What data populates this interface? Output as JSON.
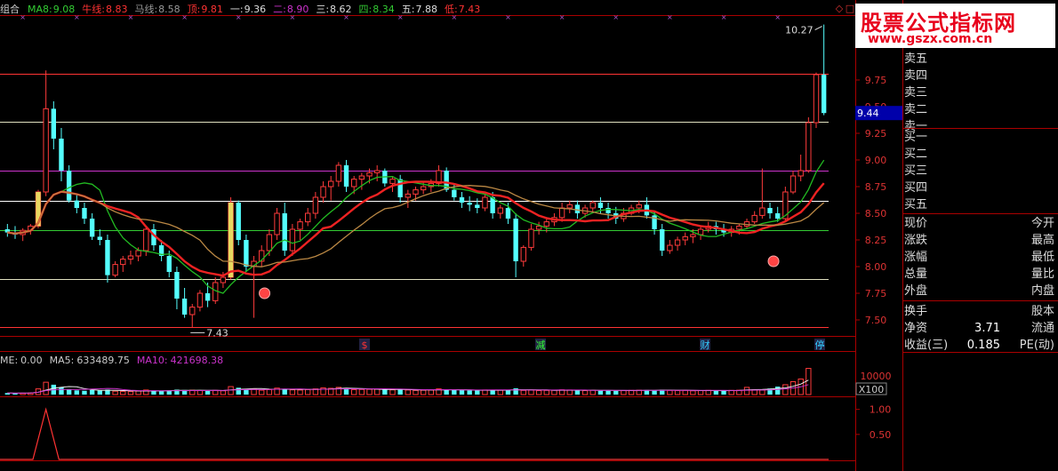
{
  "indicator_bar": [
    {
      "label": "组合",
      "value": "",
      "color": "#cccccc"
    },
    {
      "label": "MA8:",
      "value": "9.08",
      "color": "#33cc33"
    },
    {
      "label": "牛线:",
      "value": "8.83",
      "color": "#ff3333"
    },
    {
      "label": "马线:",
      "value": "8.58",
      "color": "#999999"
    },
    {
      "label": "顶:",
      "value": "9.81",
      "color": "#ff3333"
    },
    {
      "label": "一:",
      "value": "9.36",
      "color": "#dddddd"
    },
    {
      "label": "二:",
      "value": "8.90",
      "color": "#cc33cc"
    },
    {
      "label": "三:",
      "value": "8.62",
      "color": "#dddddd"
    },
    {
      "label": "四:",
      "value": "8.34",
      "color": "#33cc33"
    },
    {
      "label": "五:",
      "value": "7.88",
      "color": "#dddddd"
    },
    {
      "label": "低:",
      "value": "7.43",
      "color": "#ff3333"
    }
  ],
  "volume_bar": [
    {
      "label": "ME:",
      "value": "0.00",
      "color": "#cccccc"
    },
    {
      "label": "MA5:",
      "value": "633489.75",
      "color": "#cccccc"
    },
    {
      "label": "MA10:",
      "value": "421698.38",
      "color": "#cc33cc"
    }
  ],
  "watermark": {
    "title": "股票公式指标网",
    "url": "www.gszx.com.cn"
  },
  "annotations": {
    "high": "10.27",
    "low": "7.43",
    "current_price": "9.44",
    "vol_unit": "X100"
  },
  "event_markers": [
    {
      "label": "$",
      "color": "#ff3333"
    },
    {
      "label": "减",
      "color": "#33ff33"
    },
    {
      "label": "财",
      "color": "#33ccff"
    },
    {
      "label": "停",
      "color": "#33ccff"
    }
  ],
  "price_axis": [
    "9.75",
    "9.50",
    "9.25",
    "9.00",
    "8.75",
    "8.50",
    "8.25",
    "8.00",
    "7.75",
    "7.50"
  ],
  "volume_axis": [
    "10000"
  ],
  "sub_axis": [
    "1.00",
    "0.50"
  ],
  "panel": {
    "sell": [
      "卖五",
      "卖四",
      "卖三",
      "卖二",
      "卖一"
    ],
    "buy": [
      "买一",
      "买二",
      "买三",
      "买四",
      "买五"
    ],
    "stats": [
      {
        "l": "现价",
        "v": "",
        "r": "今开"
      },
      {
        "l": "涨跌",
        "v": "",
        "r": "最高"
      },
      {
        "l": "涨幅",
        "v": "",
        "r": "最低"
      },
      {
        "l": "总量",
        "v": "",
        "r": "量比"
      },
      {
        "l": "外盘",
        "v": "",
        "r": "内盘"
      },
      {
        "l": "换手",
        "v": "",
        "r": "股本"
      },
      {
        "l": "净资",
        "v": "3.71",
        "r": "流通"
      },
      {
        "l": "收益(三)",
        "v": "0.185",
        "r": "PE(动)"
      }
    ]
  },
  "chart_data": {
    "type": "candlestick",
    "ylim": [
      7.35,
      10.35
    ],
    "levels": [
      {
        "name": "顶",
        "value": 9.81,
        "color": "#ff3333"
      },
      {
        "name": "一",
        "value": 9.36,
        "color": "#e0e0c0"
      },
      {
        "name": "二",
        "value": 8.9,
        "color": "#cc33cc"
      },
      {
        "name": "三",
        "value": 8.62,
        "color": "#ffffff"
      },
      {
        "name": "四",
        "value": 8.34,
        "color": "#33cc33"
      },
      {
        "name": "五",
        "value": 7.88,
        "color": "#e0e0c0"
      },
      {
        "name": "低",
        "value": 7.43,
        "color": "#ff3333"
      }
    ],
    "candles": [
      [
        8.35,
        8.4,
        8.28,
        8.32
      ],
      [
        8.32,
        8.38,
        8.26,
        8.3
      ],
      [
        8.3,
        8.36,
        8.24,
        8.34
      ],
      [
        8.34,
        8.4,
        8.3,
        8.38
      ],
      [
        8.38,
        8.72,
        8.36,
        8.7
      ],
      [
        8.7,
        9.84,
        8.66,
        9.48
      ],
      [
        9.48,
        9.55,
        9.1,
        9.2
      ],
      [
        9.2,
        9.3,
        8.8,
        8.9
      ],
      [
        8.9,
        8.95,
        8.6,
        8.62
      ],
      [
        8.62,
        8.68,
        8.5,
        8.55
      ],
      [
        8.55,
        8.6,
        8.4,
        8.45
      ],
      [
        8.45,
        8.5,
        8.25,
        8.28
      ],
      [
        8.28,
        8.35,
        8.2,
        8.25
      ],
      [
        8.25,
        8.3,
        7.85,
        7.92
      ],
      [
        7.92,
        8.05,
        7.9,
        8.02
      ],
      [
        8.02,
        8.1,
        7.95,
        8.07
      ],
      [
        8.07,
        8.15,
        8.02,
        8.1
      ],
      [
        8.1,
        8.18,
        8.05,
        8.15
      ],
      [
        8.15,
        8.38,
        8.1,
        8.35
      ],
      [
        8.35,
        8.4,
        8.15,
        8.2
      ],
      [
        8.2,
        8.25,
        8.05,
        8.1
      ],
      [
        8.1,
        8.15,
        7.9,
        7.95
      ],
      [
        7.95,
        8.0,
        7.6,
        7.7
      ],
      [
        7.7,
        7.8,
        7.52,
        7.55
      ],
      [
        7.55,
        7.65,
        7.43,
        7.62
      ],
      [
        7.62,
        7.78,
        7.58,
        7.75
      ],
      [
        7.75,
        7.85,
        7.62,
        7.68
      ],
      [
        7.68,
        7.9,
        7.65,
        7.85
      ],
      [
        7.85,
        7.95,
        7.8,
        7.9
      ],
      [
        7.9,
        8.65,
        7.88,
        8.6
      ],
      [
        8.6,
        8.62,
        8.2,
        8.25
      ],
      [
        8.25,
        8.3,
        7.95,
        8.0
      ],
      [
        8.0,
        8.1,
        7.52,
        8.05
      ],
      [
        8.05,
        8.2,
        8.0,
        8.15
      ],
      [
        8.15,
        8.35,
        8.1,
        8.3
      ],
      [
        8.3,
        8.55,
        8.25,
        8.5
      ],
      [
        8.5,
        8.6,
        8.1,
        8.15
      ],
      [
        8.15,
        8.4,
        8.1,
        8.35
      ],
      [
        8.35,
        8.45,
        8.25,
        8.42
      ],
      [
        8.42,
        8.55,
        8.38,
        8.5
      ],
      [
        8.5,
        8.7,
        8.45,
        8.65
      ],
      [
        8.65,
        8.8,
        8.6,
        8.75
      ],
      [
        8.75,
        8.85,
        8.62,
        8.8
      ],
      [
        8.8,
        8.98,
        8.75,
        8.95
      ],
      [
        8.95,
        9.0,
        8.7,
        8.75
      ],
      [
        8.75,
        8.85,
        8.68,
        8.82
      ],
      [
        8.82,
        8.88,
        8.72,
        8.85
      ],
      [
        8.85,
        8.92,
        8.78,
        8.88
      ],
      [
        8.88,
        8.95,
        8.8,
        8.9
      ],
      [
        8.9,
        8.92,
        8.75,
        8.78
      ],
      [
        8.78,
        8.85,
        8.7,
        8.82
      ],
      [
        8.82,
        8.86,
        8.6,
        8.65
      ],
      [
        8.65,
        8.72,
        8.55,
        8.68
      ],
      [
        8.68,
        8.75,
        8.62,
        8.72
      ],
      [
        8.72,
        8.8,
        8.68,
        8.75
      ],
      [
        8.75,
        8.82,
        8.7,
        8.78
      ],
      [
        8.78,
        8.95,
        8.75,
        8.9
      ],
      [
        8.9,
        8.93,
        8.7,
        8.72
      ],
      [
        8.72,
        8.78,
        8.62,
        8.65
      ],
      [
        8.65,
        8.7,
        8.55,
        8.6
      ],
      [
        8.6,
        8.66,
        8.52,
        8.58
      ],
      [
        8.58,
        8.64,
        8.5,
        8.55
      ],
      [
        8.55,
        8.68,
        8.52,
        8.65
      ],
      [
        8.65,
        8.7,
        8.45,
        8.5
      ],
      [
        8.5,
        8.58,
        8.45,
        8.55
      ],
      [
        8.55,
        8.6,
        8.4,
        8.45
      ],
      [
        8.45,
        8.5,
        7.9,
        8.05
      ],
      [
        8.05,
        8.2,
        8.0,
        8.18
      ],
      [
        8.18,
        8.4,
        8.15,
        8.35
      ],
      [
        8.35,
        8.42,
        8.3,
        8.38
      ],
      [
        8.38,
        8.45,
        8.32,
        8.42
      ],
      [
        8.42,
        8.5,
        8.38,
        8.46
      ],
      [
        8.46,
        8.6,
        8.42,
        8.55
      ],
      [
        8.55,
        8.62,
        8.5,
        8.58
      ],
      [
        8.58,
        8.62,
        8.45,
        8.5
      ],
      [
        8.5,
        8.58,
        8.46,
        8.55
      ],
      [
        8.55,
        8.62,
        8.5,
        8.6
      ],
      [
        8.6,
        8.65,
        8.5,
        8.55
      ],
      [
        8.55,
        8.6,
        8.45,
        8.5
      ],
      [
        8.5,
        8.56,
        8.4,
        8.45
      ],
      [
        8.45,
        8.55,
        8.42,
        8.5
      ],
      [
        8.5,
        8.58,
        8.48,
        8.55
      ],
      [
        8.55,
        8.62,
        8.5,
        8.58
      ],
      [
        8.58,
        8.65,
        8.45,
        8.48
      ],
      [
        8.48,
        8.52,
        8.3,
        8.35
      ],
      [
        8.35,
        8.4,
        8.1,
        8.15
      ],
      [
        8.15,
        8.25,
        8.12,
        8.2
      ],
      [
        8.2,
        8.28,
        8.15,
        8.25
      ],
      [
        8.25,
        8.32,
        8.2,
        8.28
      ],
      [
        8.28,
        8.35,
        8.22,
        8.3
      ],
      [
        8.3,
        8.38,
        8.25,
        8.35
      ],
      [
        8.35,
        8.42,
        8.32,
        8.38
      ],
      [
        8.38,
        8.42,
        8.3,
        8.35
      ],
      [
        8.35,
        8.4,
        8.28,
        8.32
      ],
      [
        8.32,
        8.38,
        8.28,
        8.35
      ],
      [
        8.35,
        8.4,
        8.3,
        8.38
      ],
      [
        8.38,
        8.45,
        8.35,
        8.42
      ],
      [
        8.42,
        8.52,
        8.4,
        8.48
      ],
      [
        8.48,
        8.92,
        8.45,
        8.55
      ],
      [
        8.55,
        8.6,
        8.45,
        8.5
      ],
      [
        8.5,
        8.56,
        8.42,
        8.45
      ],
      [
        8.45,
        8.75,
        8.42,
        8.7
      ],
      [
        8.7,
        8.9,
        8.68,
        8.85
      ],
      [
        8.85,
        9.05,
        8.8,
        8.9
      ],
      [
        8.9,
        9.4,
        8.88,
        9.35
      ],
      [
        9.35,
        9.82,
        9.3,
        9.8
      ],
      [
        9.8,
        10.27,
        9.42,
        9.44
      ]
    ],
    "ma_series": [
      {
        "name": "MA8",
        "color": "#22bb22"
      },
      {
        "name": "牛线",
        "color": "#ee2222"
      },
      {
        "name": "马线",
        "color": "#bb8844"
      }
    ],
    "volume": [
      80,
      70,
      75,
      85,
      300,
      650,
      520,
      380,
      260,
      220,
      200,
      240,
      210,
      260,
      180,
      170,
      160,
      190,
      240,
      200,
      180,
      220,
      260,
      240,
      230,
      210,
      190,
      220,
      200,
      420,
      360,
      280,
      300,
      230,
      260,
      340,
      300,
      250,
      240,
      260,
      300,
      350,
      330,
      380,
      320,
      260,
      270,
      280,
      290,
      260,
      250,
      280,
      240,
      220,
      230,
      240,
      300,
      260,
      240,
      230,
      220,
      210,
      240,
      250,
      230,
      240,
      330,
      220,
      240,
      210,
      220,
      230,
      250,
      240,
      220,
      210,
      230,
      220,
      210,
      200,
      210,
      220,
      230,
      240,
      230,
      260,
      220,
      210,
      220,
      200,
      210,
      220,
      200,
      210,
      220,
      230,
      380,
      260,
      240,
      320,
      420,
      520,
      680,
      820,
      1380
    ]
  }
}
